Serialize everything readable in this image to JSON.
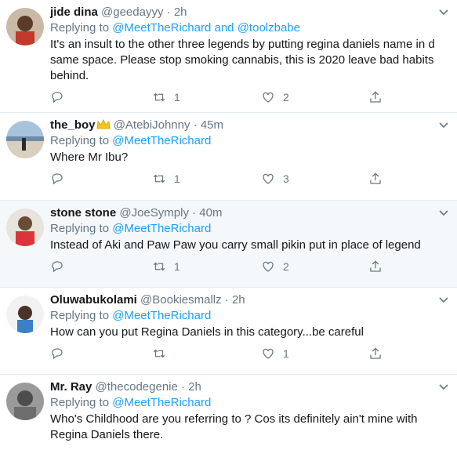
{
  "tweets": [
    {
      "name": "jide dina",
      "handle": "@geedayyy",
      "dot": "·",
      "time": "2h",
      "replying_prefix": "Replying to",
      "mention1": "@MeetTheRichard",
      "and_text": "and",
      "mention2": "@toolzbabe",
      "text": "It's an insult to the other three legends by putting regina daniels name in d same space. Please stop smoking cannabis, this is 2020 leave bad habits behind.",
      "reply_count": "",
      "retweet_count": "1",
      "like_count": "2"
    },
    {
      "name": "the_boy",
      "handle": "@AtebiJohnny",
      "dot": "·",
      "time": "45m",
      "replying_prefix": "Replying to",
      "mention1": "@MeetTheRichard",
      "text": "Where Mr Ibu?",
      "reply_count": "",
      "retweet_count": "1",
      "like_count": "3"
    },
    {
      "name": "stone stone",
      "handle": "@JoeSymply",
      "dot": "·",
      "time": "40m",
      "replying_prefix": "Replying to",
      "mention1": "@MeetTheRichard",
      "text": "Instead of Aki and Paw Paw you carry small pikin  put in place of legend",
      "reply_count": "",
      "retweet_count": "1",
      "like_count": "2"
    },
    {
      "name": "Oluwabukolami",
      "handle": "@Bookiesmallz",
      "dot": "·",
      "time": "2h",
      "replying_prefix": "Replying to",
      "mention1": "@MeetTheRichard",
      "text": "How can you put Regina Daniels in this category...be careful",
      "reply_count": "",
      "retweet_count": "",
      "like_count": "1"
    },
    {
      "name": "Mr. Ray",
      "handle": "@thecodegenie",
      "dot": "·",
      "time": "2h",
      "replying_prefix": "Replying to",
      "mention1": "@MeetTheRichard",
      "text": "Who's Childhood are you referring to ? Cos its definitely ain't mine with Regina Daniels there.",
      "reply_count": "",
      "retweet_count": "",
      "like_count": ""
    }
  ],
  "icons": {
    "reply": "reply-icon",
    "retweet": "retweet-icon",
    "like": "heart-icon",
    "share": "share-icon",
    "more": "chevron-down-icon",
    "crown": "crown-icon"
  },
  "colors": {
    "link": "#1da1f2",
    "muted": "#657786",
    "text": "#14171a",
    "highlight_bg": "#f5f8fa"
  }
}
